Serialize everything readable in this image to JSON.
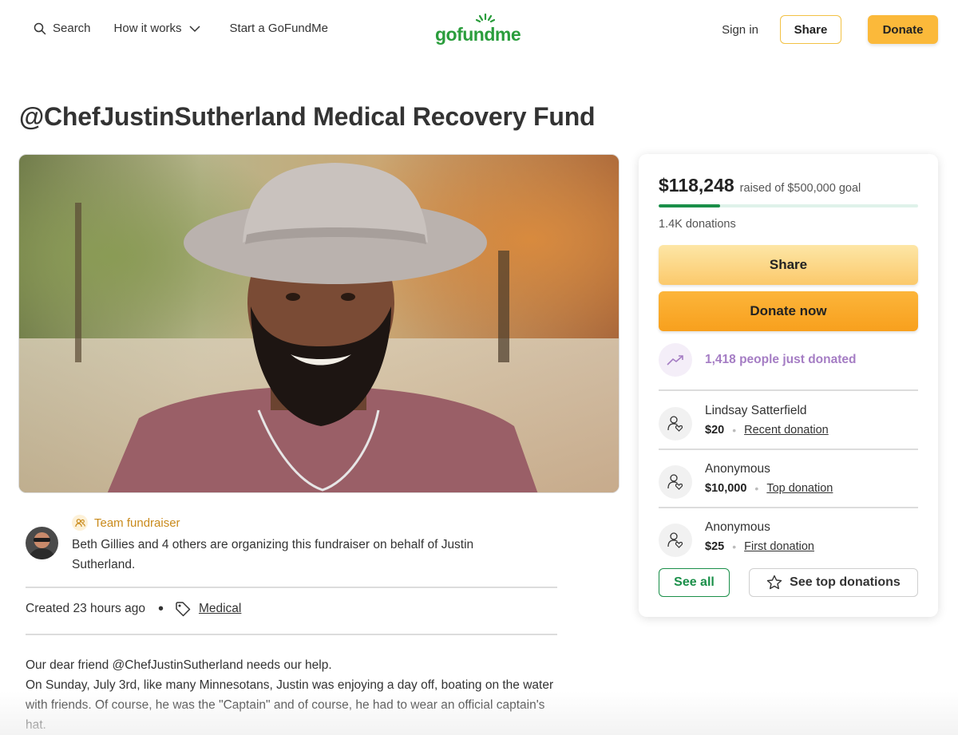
{
  "nav": {
    "search_label": "Search",
    "how_it_works_label": "How it works",
    "start_label": "Start a GoFundMe",
    "logo_text": "gofundme",
    "sign_in_label": "Sign in",
    "share_label": "Share",
    "donate_label": "Donate"
  },
  "page": {
    "title": "@ChefJustinSutherland Medical Recovery Fund"
  },
  "organizer": {
    "badge_label": "Team fundraiser",
    "text": "Beth Gillies and 4 others are organizing this fundraiser on behalf of Justin Sutherland.",
    "created": "Created 23 hours ago",
    "separator": "•",
    "category": "Medical"
  },
  "story": {
    "paragraph_1": "Our dear friend @ChefJustinSutherland needs our help.",
    "paragraph_2": "On Sunday, July 3rd, like many Minnesotans, Justin was enjoying a day off, boating on the water with friends. Of course, he was the \"Captain\" and of course, he had to wear an official captain's hat."
  },
  "donation_card": {
    "raised_amount": "$118,248",
    "goal_text": "raised of $500,000 goal",
    "progress_fraction": 0.2365,
    "donation_count": "1.4K donations",
    "share_label": "Share",
    "donate_now_label": "Donate now",
    "recent_activity": "1,418 people just donated",
    "donors": [
      {
        "name": "Lindsay Satterfield",
        "amount": "$20",
        "type": "Recent donation"
      },
      {
        "name": "Anonymous",
        "amount": "$10,000",
        "type": "Top donation"
      },
      {
        "name": "Anonymous",
        "amount": "$25",
        "type": "First donation"
      }
    ],
    "see_all_label": "See all",
    "see_top_label": "See top donations"
  },
  "colors": {
    "brand_green": "#1a8f49",
    "accent_yellow": "#fbb93a",
    "activity_purple": "#a57dc4",
    "badge_gold": "#c98a1b"
  },
  "icons": {
    "search": "search-icon",
    "chevron": "chevron-down-icon",
    "team": "team-icon",
    "tag": "tag-icon",
    "trend": "trending-up-icon",
    "donor": "donor-heart-icon",
    "star": "star-icon"
  }
}
